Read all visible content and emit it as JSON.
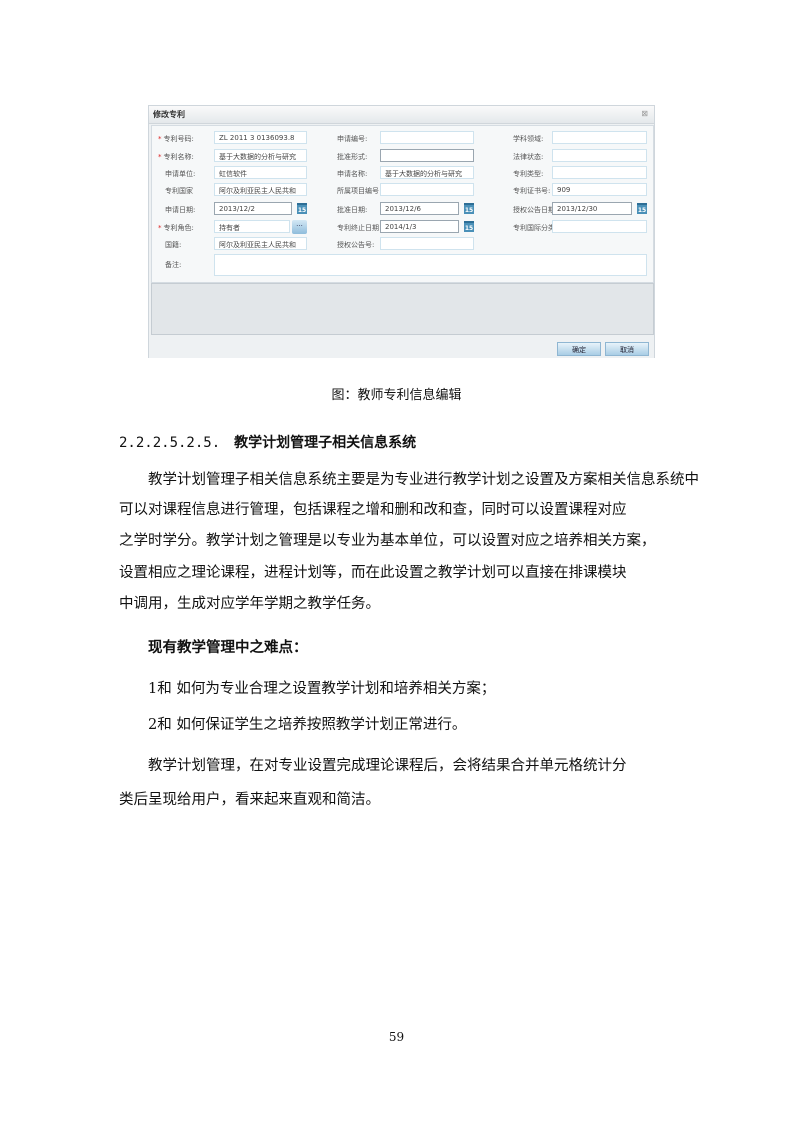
{
  "dialog": {
    "title": "修改专利",
    "close": "⊠",
    "rows": [
      [
        {
          "label": "专利号码:",
          "required": true,
          "value": "ZL 2011 3 0136093.8"
        },
        {
          "label": "申请编号:",
          "value": ""
        },
        {
          "label": "学科领域:",
          "value": ""
        }
      ],
      [
        {
          "label": "专利名称:",
          "required": true,
          "value": "基于大数据的分析与研究"
        },
        {
          "label": "批准形式:",
          "value": ""
        },
        {
          "label": "法律状态:",
          "value": ""
        }
      ],
      [
        {
          "label": "申请单位:",
          "value": "虹信软件"
        },
        {
          "label": "申请名称:",
          "value": "基于大数据的分析与研究"
        },
        {
          "label": "专利类型:",
          "value": ""
        }
      ],
      [
        {
          "label": "专利国家",
          "value": "阿尔及利亚民主人民共和"
        },
        {
          "label": "所属项目编号",
          "value": ""
        },
        {
          "label": "专利证书号:",
          "value": "909"
        }
      ],
      [
        {
          "label": "申请日期:",
          "value": "2013/12/2"
        },
        {
          "label": "批准日期:",
          "value": "2013/12/6"
        },
        {
          "label": "授权公告日期",
          "value": "2013/12/30"
        }
      ],
      [
        {
          "label": "专利角色:",
          "required": true,
          "value": "持有者"
        },
        {
          "label": "专利终止日期",
          "value": "2014/1/3"
        },
        {
          "label": "专利国际分类",
          "value": ""
        }
      ],
      [
        {
          "label": "国籍:",
          "value": "阿尔及利亚民主人民共和"
        },
        {
          "label": "授权公告号:",
          "value": ""
        }
      ]
    ],
    "note_label": "备注:",
    "note_value": "",
    "calendar": "15",
    "picker": "...",
    "required_mark": "*",
    "ok": "确定",
    "cancel": "取消"
  },
  "caption": "图：教师专利信息编辑",
  "section": {
    "number": "2.2.2.5.2.5.",
    "title": "教学计划管理子相关信息系统"
  },
  "paragraphs": [
    "　　教学计划管理子相关信息系统主要是为专业进行教学计划之设置及方案相关信息系统中",
    "可以对课程信息进行管理，包括课程之增和删和改和查，同时可以设置课程对应",
    "之学时学分。教学计划之管理是以专业为基本单位，可以设置对应之培养相关方案，",
    "设置相应之理论课程，进程计划等，而在此设置之教学计划可以直接在排课模块",
    "中调用，生成对应学年学期之教学任务。",
    "　　现有教学管理中之难点：",
    "　　1和 如何为专业合理之设置教学计划和培养相关方案；",
    "　　2和 如何保证学生之培养按照教学计划正常进行。",
    "　　教学计划管理，在对专业设置完成理论课程后，会将结果合并单元格统计分",
    "类后呈现给用户，看来起来直观和简洁。"
  ],
  "page_number": "59"
}
